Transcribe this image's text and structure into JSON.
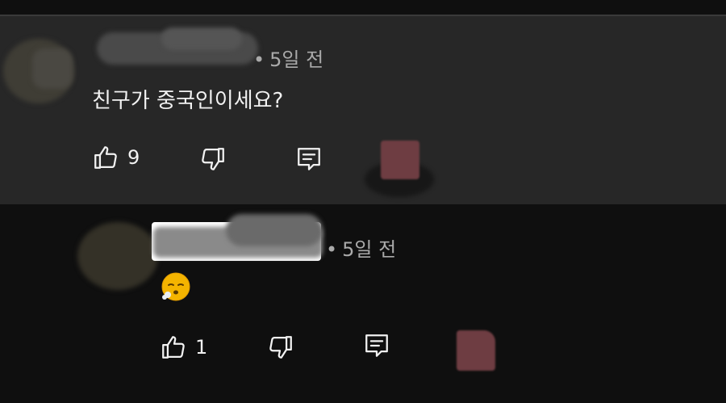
{
  "comments": [
    {
      "time": "5일 전",
      "text": "친구가 중국인이세요?",
      "likes": "9",
      "icons": {
        "like": "thumbs-up-icon",
        "dislike": "thumbs-down-icon",
        "reply": "reply-icon"
      }
    },
    {
      "time": "5일 전",
      "emoji": "😮‍💨",
      "likes": "1",
      "icons": {
        "like": "thumbs-up-icon",
        "dislike": "thumbs-down-icon",
        "reply": "reply-icon"
      }
    }
  ],
  "colors": {
    "background": "#0f0f0f",
    "highlight": "#272727",
    "secondary_text": "#aaaaaa",
    "primary_text": "#f1f1f1",
    "redaction": "#6e3d42"
  }
}
